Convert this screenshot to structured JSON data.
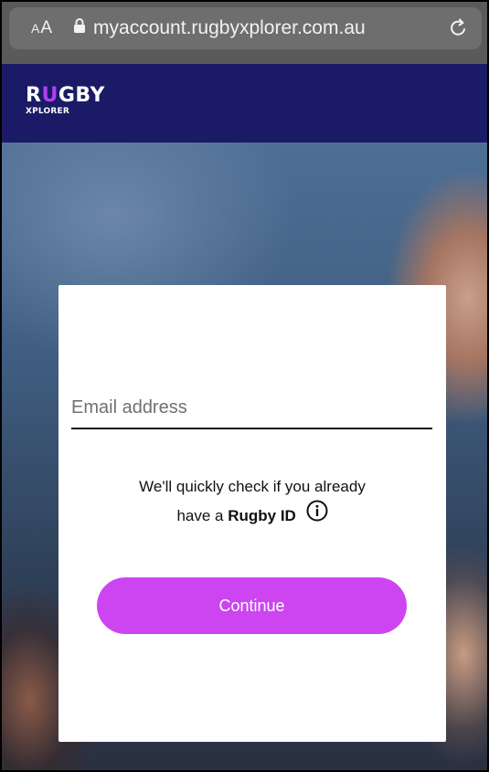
{
  "browser": {
    "text_size_label_small": "A",
    "text_size_label_large": "A",
    "url": "myaccount.rugbyxplorer.com.au"
  },
  "header": {
    "logo_letters": [
      "R",
      "U",
      "GBY"
    ],
    "logo_subtitle": "XPLORER",
    "logo_accent_color": "#b33ff0",
    "background_color": "#1a1a66"
  },
  "form": {
    "email_placeholder": "Email address",
    "email_value": "",
    "helper_line1": "We'll quickly check if you already",
    "helper_line2_prefix": "have a",
    "helper_brand": "Rugby ID",
    "continue_label": "Continue",
    "button_color": "#cc45f0"
  },
  "icons": {
    "lock": "lock-icon",
    "reload": "reload-icon",
    "info": "info-icon"
  }
}
